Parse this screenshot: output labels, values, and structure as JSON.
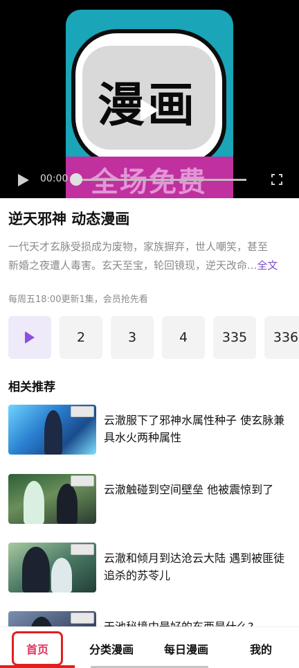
{
  "player": {
    "poster_title": "漫画",
    "poster_banner": "全场免费",
    "current_time": "00:00"
  },
  "show": {
    "title": "逆天邪神 动态漫画",
    "description_line1": "一代天才玄脉受损成为废物，家族摒弃，世人嘲笑，甚至",
    "description_line2": "新婚之夜遭人毒害。玄天至宝，轮回镜现，逆天改命",
    "ellipsis": "...",
    "full_text_link": "全文",
    "schedule": "每周五18:00更新1集，会员抢先看"
  },
  "episodes": {
    "items": [
      "2",
      "3",
      "4",
      "335",
      "336"
    ]
  },
  "recommendations": {
    "section_title": "相关推荐",
    "items": [
      {
        "title": "云澈服下了邪神水属性种子 使玄脉兼具水火两种属性"
      },
      {
        "title": "云澈触碰到空间壁垒 他被震惊到了"
      },
      {
        "title": "云澈和倾月到达沧云大陆 遇到被匪徒追杀的苏苓儿"
      },
      {
        "title": "天池秘境中最好的东西是什么?"
      }
    ]
  },
  "nav": {
    "home": "首页",
    "categories": "分类漫画",
    "daily": "每日漫画",
    "mine": "我的"
  },
  "colors": {
    "accent_purple": "#8a4fe0",
    "nav_active": "#e0325d",
    "highlight": "#c7ef7a"
  }
}
